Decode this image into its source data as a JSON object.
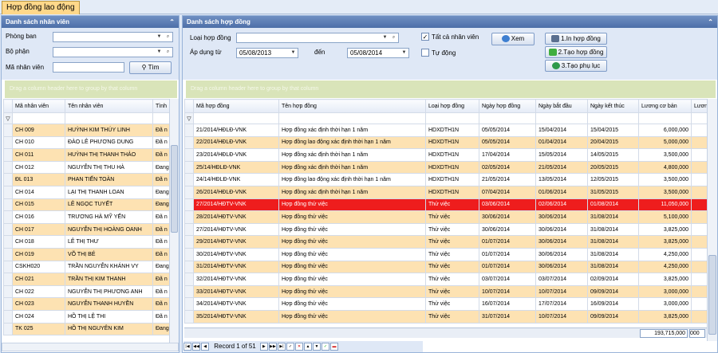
{
  "tab": {
    "label": "Hợp đồng lao động"
  },
  "left": {
    "title": "Danh sách nhân viên",
    "labels": {
      "dept": "Phòng ban",
      "section": "Bộ phận",
      "emp_code": "Mã nhân viên"
    },
    "search_btn": "Tìm",
    "group_hint": "Drag a column header here to group by that column",
    "columns": [
      "Mã nhân viên",
      "Tên nhân viên",
      "Tình"
    ],
    "rows": [
      [
        "CH 009",
        "HUỲNH KIM THÚY  LINH",
        "Đã n"
      ],
      [
        "CH 010",
        "ĐÀO LÊ PHƯƠNG DUNG",
        "Đã n"
      ],
      [
        "CH 011",
        "HUỲNH THỊ THANH THẢO",
        "Đã n"
      ],
      [
        "CH 012",
        "NGUYỄN THỊ THU  HÀ",
        "Đang"
      ],
      [
        "ĐL 013",
        "PHAN TIẾN TOÀN",
        "Đã n"
      ],
      [
        "CH 014",
        "LẠI THỊ THANH  LOAN",
        "Đang"
      ],
      [
        "CH 015",
        "LÊ NGỌC TUYẾT",
        "Đang"
      ],
      [
        "CH 016",
        "TRƯƠNG HÀ MỸ  YẾN",
        "Đã n"
      ],
      [
        "CH 017",
        "NGUYỄN THỊ HOÀNG OANH",
        "Đã n"
      ],
      [
        "CH 018",
        "LÊ THỊ  THƯ",
        "Đã n"
      ],
      [
        "CH 019",
        "VÕ THỊ  BÉ",
        "Đã n"
      ],
      [
        "CSKH020",
        "TRẦN NGUYỄN KHÁNH VY",
        "Đang"
      ],
      [
        "CH 021",
        "TRẦN THỊ KIM THANH",
        "Đã n"
      ],
      [
        "CH 022",
        "NGUYỄN THỊ PHƯƠNG ANH",
        "Đã n"
      ],
      [
        "CH 023",
        "NGUYỄN THANH  HUYỀN",
        "Đã n"
      ],
      [
        "CH 024",
        "HỒ THỊ LỆ  THI",
        "Đã n"
      ],
      [
        "TK 025",
        "HỒ THỊ NGUYÊN KIM",
        "Đang"
      ]
    ]
  },
  "right": {
    "title": "Danh sách hợp đồng",
    "labels": {
      "contract_type": "Loại hợp đồng",
      "apply_from": "Áp dụng từ",
      "to": "đến"
    },
    "date_from": "05/08/2013",
    "date_to": "05/08/2014",
    "all_employees": "Tất cả nhân viên",
    "auto": "Tự động",
    "view_btn": "Xem",
    "print_btn": "1.In hợp đồng",
    "create_btn": "2.Tạo hợp đồng",
    "appendix_btn": "3.Tạo phụ lục",
    "group_hint": "Drag a column header here to group by that column",
    "columns": [
      "Mã hợp đồng",
      "Tên hợp đồng",
      "Loại hợp đồng",
      "Ngày hợp đồng",
      "Ngày bắt đầu",
      "Ngày kết thúc",
      "Lương cơ bản",
      "Lươn"
    ],
    "rows": [
      [
        "21/2014/HĐLĐ-VNK",
        "Hợp đồng xác định thời hạn 1 năm",
        "HDXDTH1N",
        "05/05/2014",
        "15/04/2014",
        "15/04/2015",
        "6,000,000"
      ],
      [
        "22/2014/HĐLĐ-VNK",
        "Hợp đồng lao động xác định thời hạn 1 năm",
        "HDXDTH1N",
        "05/05/2014",
        "01/04/2014",
        "20/04/2015",
        "5,000,000"
      ],
      [
        "23/2014/HĐLĐ-VNK",
        "Hợp đồng xác định thời hạn 1 năm",
        "HDXDTH1N",
        "17/04/2014",
        "15/05/2014",
        "14/05/2015",
        "3,500,000"
      ],
      [
        "25/14/HĐLĐ-VNK",
        "Hợp đồng xác định thời hạn 1 năm",
        "HDXDTH1N",
        "02/05/2014",
        "21/05/2014",
        "20/05/2015",
        "4,800,000"
      ],
      [
        "24/14/HĐLĐ-VNK",
        "Hợp đồng lao động xác định thời hạn 1 năm",
        "HDXDTH1N",
        "21/05/2014",
        "13/05/2014",
        "12/05/2015",
        "3,500,000"
      ],
      [
        "26/2014/HĐLĐ-VNK",
        "Hợp đồng xác định thời hạn 1 năm",
        "HDXDTH1N",
        "07/04/2014",
        "01/06/2014",
        "31/05/2015",
        "3,500,000"
      ],
      [
        "27/2014/HĐTV-VNK",
        "Hợp đồng thử việc",
        "Thử việc",
        "03/06/2014",
        "02/06/2014",
        "01/08/2014",
        "11,050,000"
      ],
      [
        "28/2014/HĐTV-VNK",
        "Hợp đồng thử việc",
        "Thử việc",
        "30/06/2014",
        "30/06/2014",
        "31/08/2014",
        "5,100,000"
      ],
      [
        "27/2014/HĐTV-VNK",
        "Hợp đồng thử việc",
        "Thử việc",
        "30/06/2014",
        "30/06/2014",
        "31/08/2014",
        "3,825,000"
      ],
      [
        "29/2014/HĐTV-VNK",
        "Hợp đồng thử việc",
        "Thử việc",
        "01/07/2014",
        "30/06/2014",
        "31/08/2014",
        "3,825,000"
      ],
      [
        "30/2014/HĐTV-VNK",
        "Hợp đồng thử việc",
        "Thử việc",
        "01/07/2014",
        "30/06/2014",
        "31/08/2014",
        "4,250,000"
      ],
      [
        "31/2014/HĐTV-VNK",
        "Hợp đồng thử việc",
        "Thử việc",
        "01/07/2014",
        "30/06/2014",
        "31/08/2014",
        "4,250,000"
      ],
      [
        "32/2014/HĐTV-VNK",
        "Hợp đồng thử việc",
        "Thử việc",
        "03/07/2014",
        "03/07/2014",
        "02/09/2014",
        "3,825,000"
      ],
      [
        "33/2014/HĐTV-VNK",
        "Hợp đồng thử việc",
        "Thử việc",
        "10/07/2014",
        "10/07/2014",
        "09/09/2014",
        "3,000,000"
      ],
      [
        "34/2014/HĐTV-VNK",
        "Hợp đồng thử việc",
        "Thử việc",
        "16/07/2014",
        "17/07/2014",
        "16/09/2014",
        "3,000,000"
      ],
      [
        "35/2014/HĐTV-VNK",
        "Hợp đồng thử việc",
        "Thử việc",
        "31/07/2014",
        "10/07/2014",
        "09/09/2014",
        "3,825,000"
      ]
    ],
    "total": "193,715,000",
    "total_next": "000",
    "record_text": "Record 1 of 51"
  },
  "colors": {
    "highlight_row": "#ee1d1d",
    "alt_row": "#fde2b2",
    "panel_header": "#5a7bb3"
  }
}
